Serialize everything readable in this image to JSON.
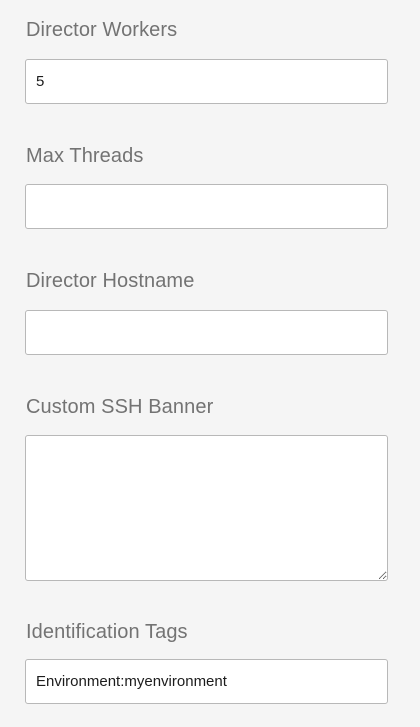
{
  "fields": [
    {
      "label": "Director Workers",
      "value": "5"
    },
    {
      "label": "Max Threads",
      "value": ""
    },
    {
      "label": "Director Hostname",
      "value": ""
    },
    {
      "label": "Custom SSH Banner",
      "value": ""
    },
    {
      "label": "Identification Tags",
      "value": "Environment:myenvironment"
    }
  ]
}
